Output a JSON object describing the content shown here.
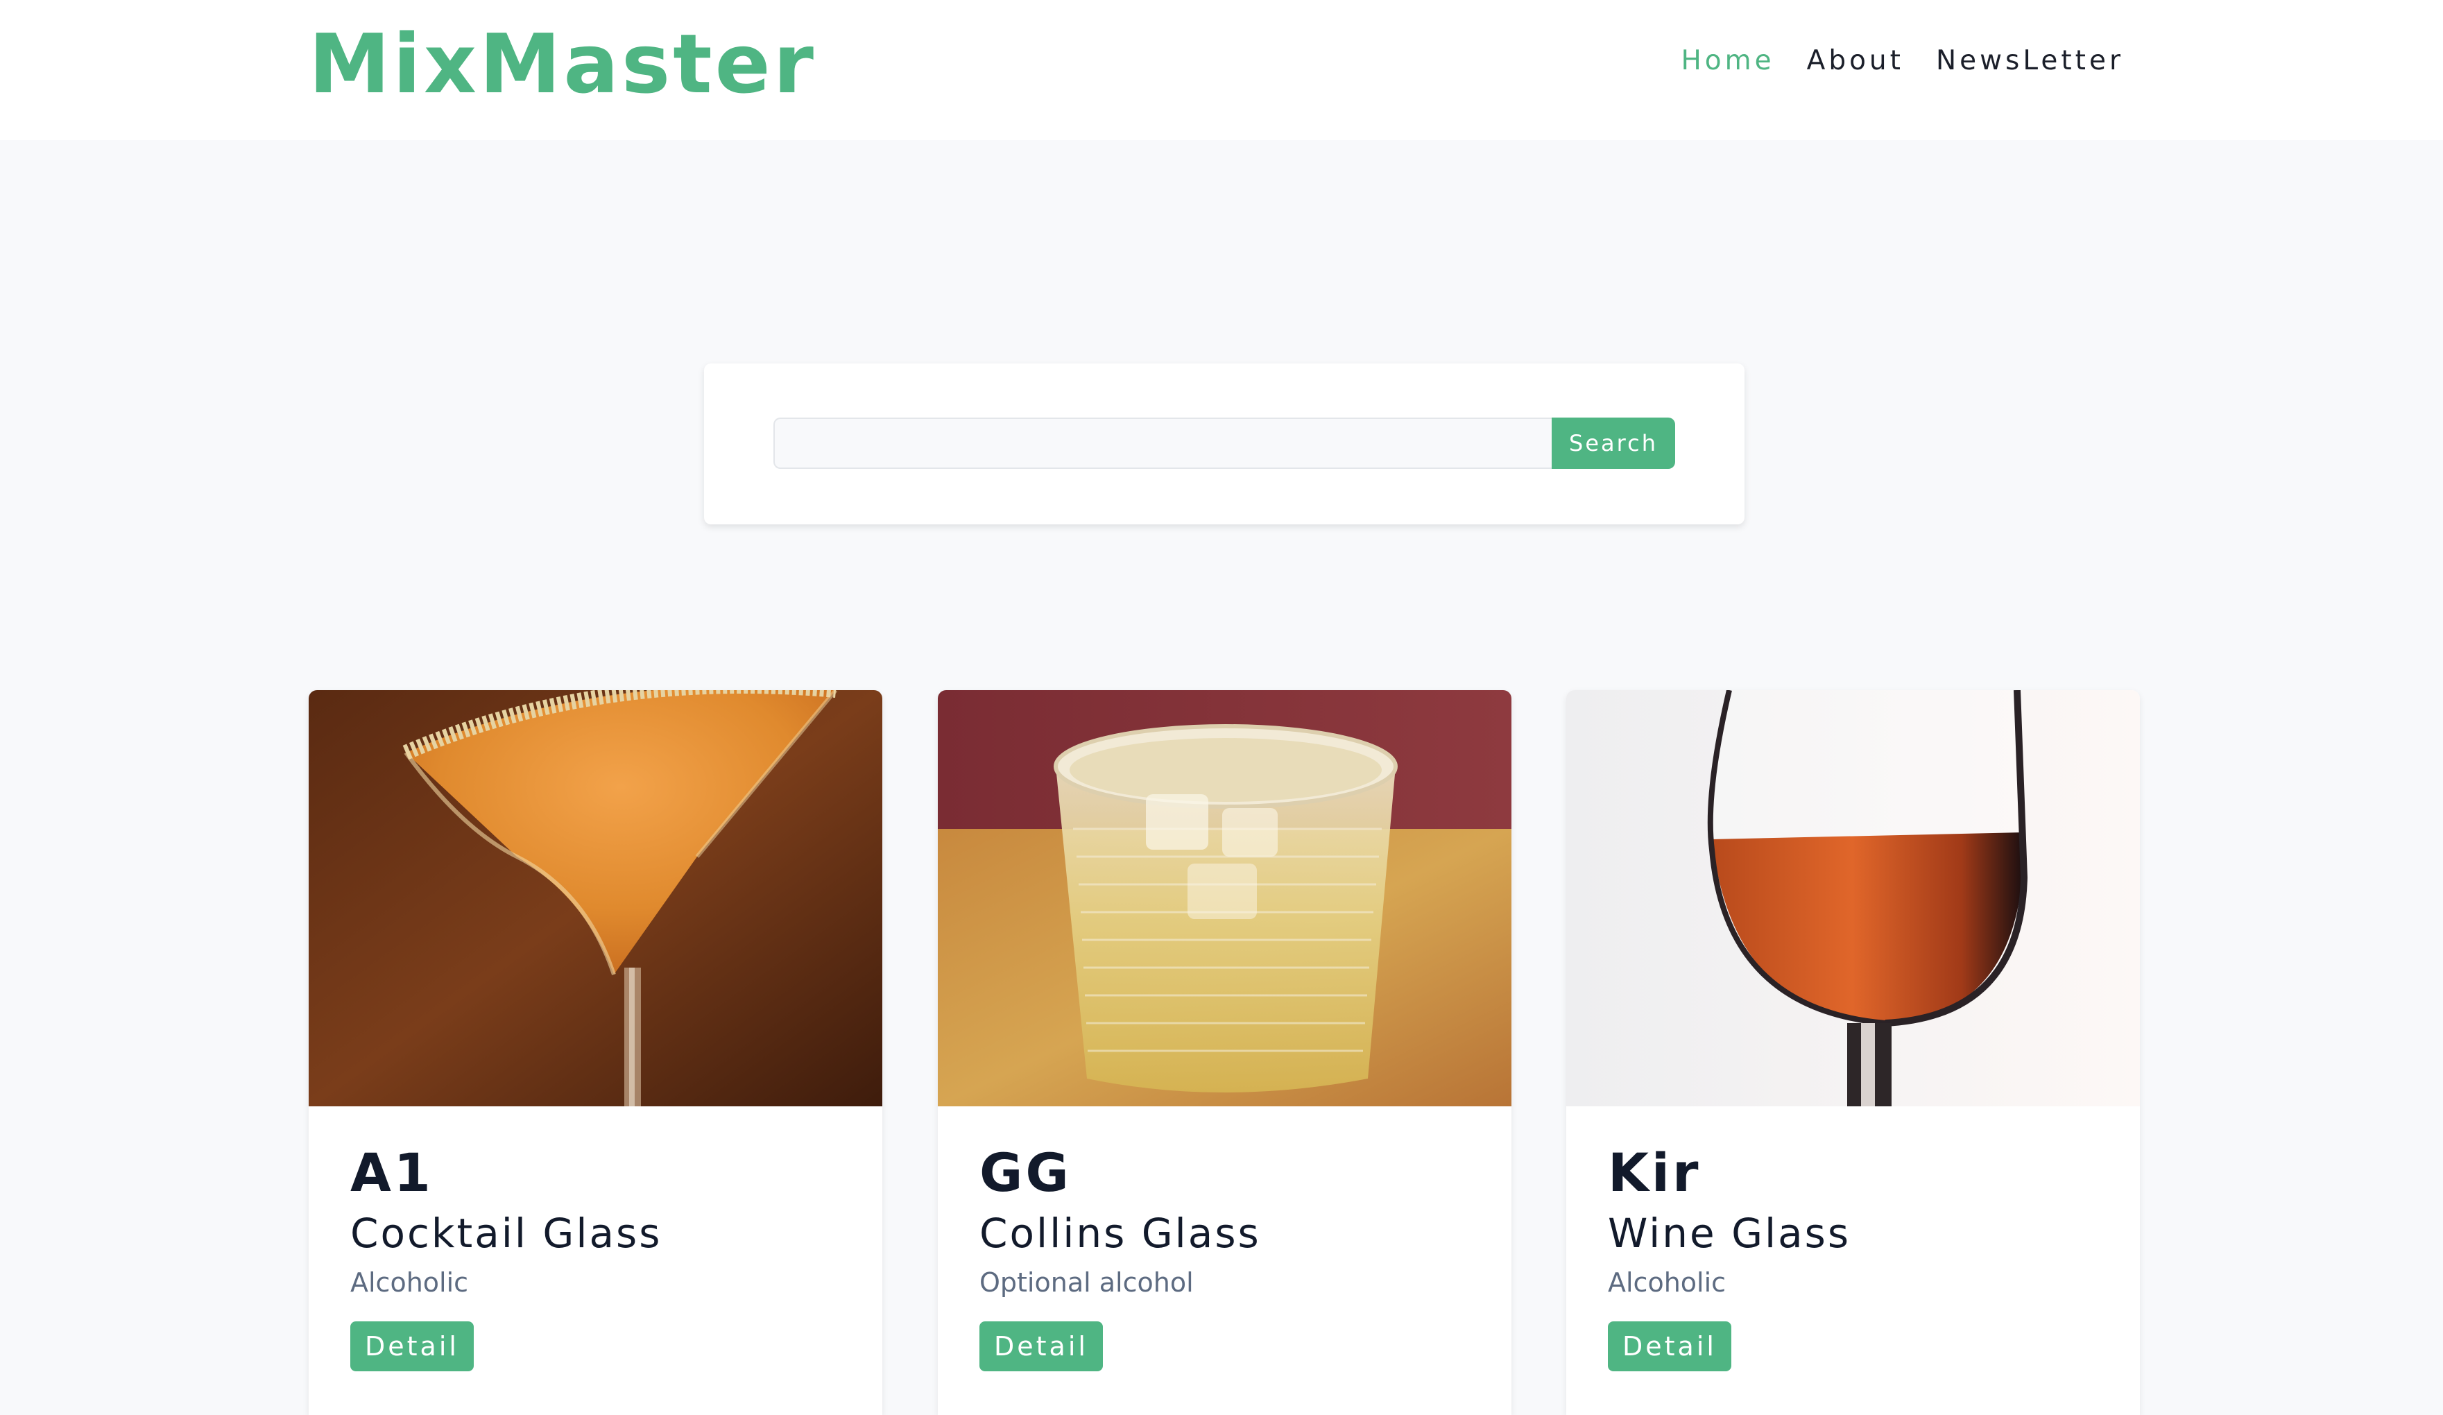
{
  "brand": {
    "name": "MixMaster",
    "accent": "#4fb583"
  },
  "nav": {
    "items": [
      {
        "label": "Home",
        "active": true
      },
      {
        "label": "About",
        "active": false
      },
      {
        "label": "NewsLetter",
        "active": false
      }
    ]
  },
  "search": {
    "value": "",
    "placeholder": "",
    "button_label": "Search"
  },
  "cocktails": [
    {
      "name": "A1",
      "glass": "Cocktail Glass",
      "alcoholic": "Alcoholic",
      "button_label": "Detail",
      "image": "orange-cocktail-in-martini-glass"
    },
    {
      "name": "GG",
      "glass": "Collins Glass",
      "alcoholic": "Optional alcohol",
      "button_label": "Detail",
      "image": "clear-drink-with-ice-in-tumbler"
    },
    {
      "name": "Kir",
      "glass": "Wine Glass",
      "alcoholic": "Alcoholic",
      "button_label": "Detail",
      "image": "red-drink-in-wine-glass"
    }
  ]
}
